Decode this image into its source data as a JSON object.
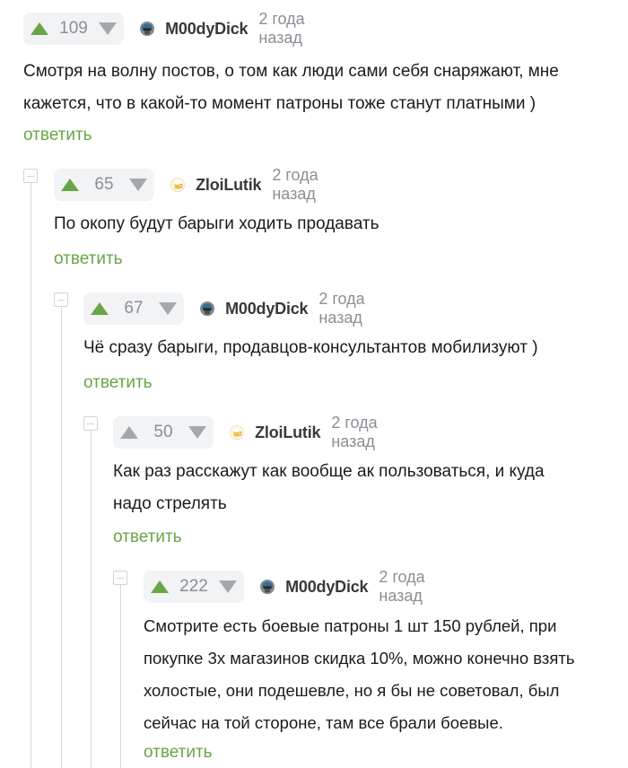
{
  "comments": [
    {
      "rating": "109",
      "author": "M00dyDick",
      "time": "2 года назад",
      "lines": [
        "Смотря на волну постов, о том как люди сами себя снаряжают, мне",
        "кажется, что в какой-то момент патроны тоже станут платными )"
      ],
      "reply": "ответить",
      "vote_state": "up",
      "avatar": "helmet-avatar"
    },
    {
      "rating": "65",
      "author": "ZloiLutik",
      "time": "2 года назад",
      "lines": [
        "По окопу будут барыги ходить продавать"
      ],
      "reply": "ответить",
      "vote_state": "up",
      "avatar": "beer-avatar"
    },
    {
      "rating": "67",
      "author": "M00dyDick",
      "time": "2 года назад",
      "lines": [
        "Чё сразу барыги, продавцов-консультантов мобилизуют )"
      ],
      "reply": "ответить",
      "vote_state": "up",
      "avatar": "helmet-avatar"
    },
    {
      "rating": "50",
      "author": "ZloiLutik",
      "time": "2 года назад",
      "lines": [
        "Как раз расскажут как вообще ак пользоваться, и куда",
        "надо стрелять"
      ],
      "reply": "ответить",
      "vote_state": "none",
      "avatar": "beer-avatar"
    },
    {
      "rating": "222",
      "author": "M00dyDick",
      "time": "2 года назад",
      "lines": [
        "Смотрите есть боевые патроны 1 шт 150 рублей, при",
        "покупке 3х магазинов скидка 10%, можно конечно взять",
        "холостые, они подешевле, но я бы не советовал, был",
        "сейчас на той стороне, там все брали боевые."
      ],
      "reply": "ответить",
      "vote_state": "up",
      "avatar": "helmet-avatar"
    }
  ],
  "colors": {
    "upvote_active": "#6aa545",
    "arrow_inactive": "#a3a8ad",
    "reply_link": "#6aa545",
    "vote_bg": "#f2f3f5"
  }
}
